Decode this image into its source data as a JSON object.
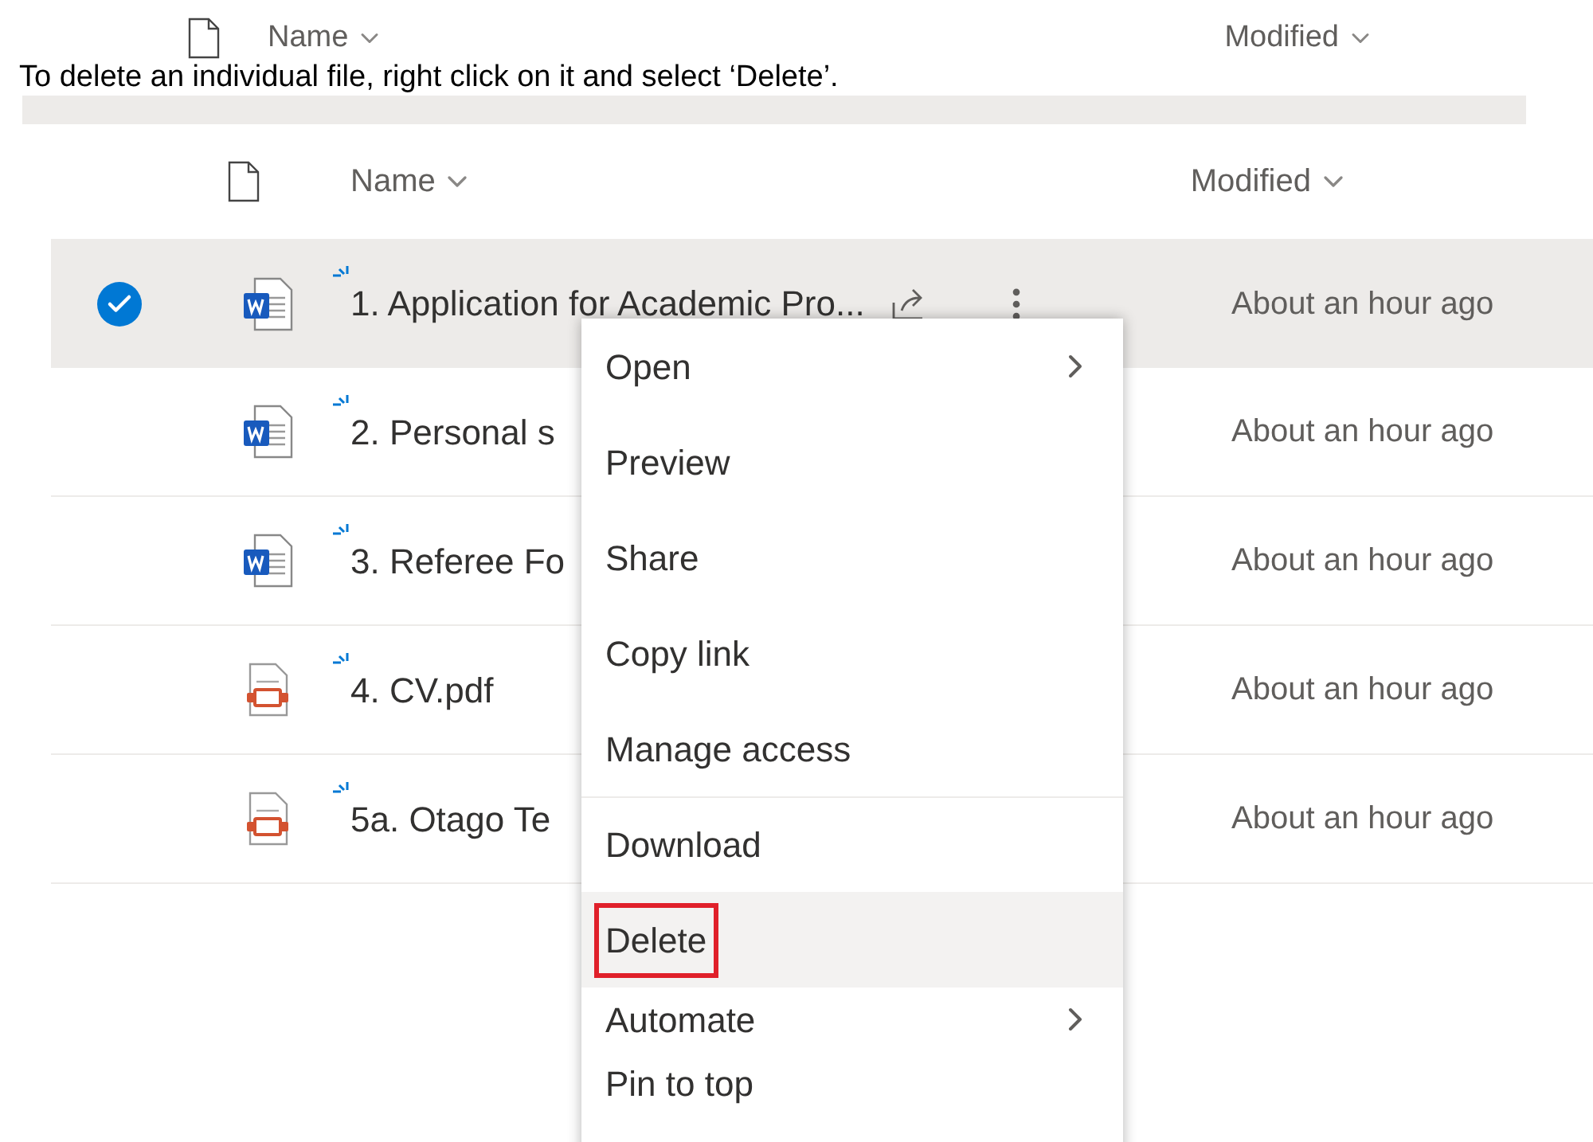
{
  "instruction": "To delete an individual file, right click on it and select ‘Delete’.",
  "ghost_header": {
    "name": "Name",
    "modified": "Modified"
  },
  "header": {
    "name": "Name",
    "modified": "Modified"
  },
  "files": [
    {
      "name": "1. Application for Academic Pro...",
      "modified": "About an hour ago",
      "kind": "word",
      "selected": true
    },
    {
      "name": "2. Personal s",
      "modified": "About an hour ago",
      "kind": "word",
      "selected": false
    },
    {
      "name": "3. Referee Fo",
      "modified": "About an hour ago",
      "kind": "word",
      "selected": false
    },
    {
      "name": "4. CV.pdf",
      "modified": "About an hour ago",
      "kind": "pdf",
      "selected": false
    },
    {
      "name": "5a. Otago Te",
      "modified": "About an hour ago",
      "kind": "pdf",
      "selected": false
    }
  ],
  "menu": [
    {
      "label": "Open",
      "submenu": true,
      "selected": false,
      "outlined": false
    },
    {
      "label": "Preview",
      "submenu": false,
      "selected": false,
      "outlined": false
    },
    {
      "label": "Share",
      "submenu": false,
      "selected": false,
      "outlined": false
    },
    {
      "label": "Copy link",
      "submenu": false,
      "selected": false,
      "outlined": false
    },
    {
      "label": "Manage access",
      "submenu": false,
      "selected": false,
      "outlined": false
    },
    {
      "label": "Download",
      "submenu": false,
      "selected": false,
      "outlined": false,
      "divider_before": true
    },
    {
      "label": "Delete",
      "submenu": false,
      "selected": true,
      "outlined": true
    },
    {
      "label": "Automate",
      "submenu": true,
      "selected": false,
      "outlined": false
    },
    {
      "label": "Pin to top",
      "submenu": false,
      "selected": false,
      "outlined": false
    }
  ]
}
